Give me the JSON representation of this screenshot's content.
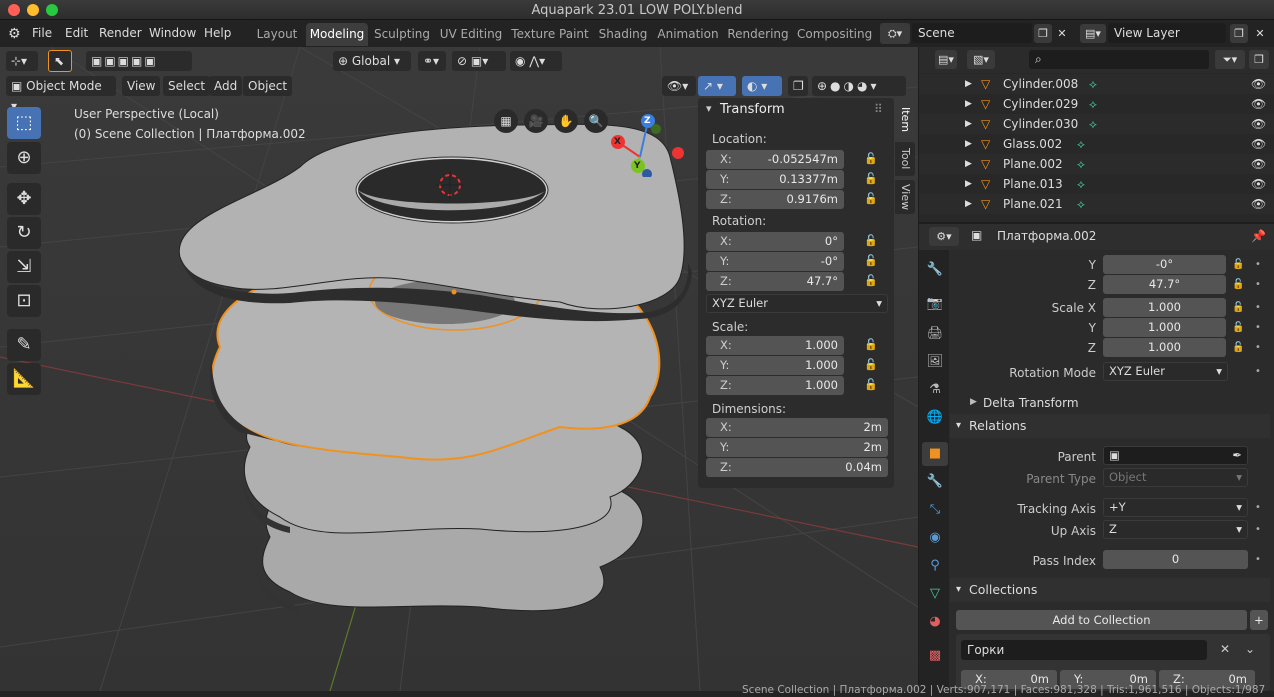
{
  "window": {
    "title": "Aquapark 23.01 LOW POLY.blend"
  },
  "menu": [
    "File",
    "Edit",
    "Render",
    "Window",
    "Help"
  ],
  "workspaces": [
    "Layout",
    "Modeling",
    "Sculpting",
    "UV Editing",
    "Texture Paint",
    "Shading",
    "Animation",
    "Rendering",
    "Compositing"
  ],
  "scene": {
    "name": "Scene",
    "view_layer": "View Layer"
  },
  "viewport": {
    "transform_orientation": "Global",
    "mode": "Object Mode",
    "menus": [
      "View",
      "Select",
      "Add",
      "Object"
    ],
    "perspective": "User Perspective (Local)",
    "collection_info": "(0) Scene Collection | Платформа.002",
    "gizmo": {
      "x": "X",
      "y": "Y",
      "z": "Z"
    }
  },
  "npanel": {
    "title": "Transform",
    "tabs": [
      "Item",
      "Tool",
      "View"
    ],
    "location_label": "Location:",
    "location": [
      {
        "axis": "X:",
        "value": "-0.052547m"
      },
      {
        "axis": "Y:",
        "value": "0.13377m"
      },
      {
        "axis": "Z:",
        "value": "0.9176m"
      }
    ],
    "rotation_label": "Rotation:",
    "rotation": [
      {
        "axis": "X:",
        "value": "0°"
      },
      {
        "axis": "Y:",
        "value": "-0°"
      },
      {
        "axis": "Z:",
        "value": "47.7°"
      }
    ],
    "rotation_mode": "XYZ Euler",
    "scale_label": "Scale:",
    "scale": [
      {
        "axis": "X:",
        "value": "1.000"
      },
      {
        "axis": "Y:",
        "value": "1.000"
      },
      {
        "axis": "Z:",
        "value": "1.000"
      }
    ],
    "dimensions_label": "Dimensions:",
    "dimensions": [
      {
        "axis": "X:",
        "value": "2m"
      },
      {
        "axis": "Y:",
        "value": "2m"
      },
      {
        "axis": "Z:",
        "value": "0.04m"
      }
    ]
  },
  "outliner": {
    "items": [
      "Cylinder.008",
      "Cylinder.029",
      "Cylinder.030",
      "Glass.002",
      "Plane.002",
      "Plane.013",
      "Plane.021"
    ]
  },
  "properties": {
    "object_name": "Платформа.002",
    "rot_y_label": "Y",
    "rot_y": "-0°",
    "rot_z_label": "Z",
    "rot_z": "47.7°",
    "scale_x_label": "Scale X",
    "scale_x": "1.000",
    "scale_y_label": "Y",
    "scale_y": "1.000",
    "scale_z_label": "Z",
    "scale_z": "1.000",
    "rotation_mode_label": "Rotation Mode",
    "rotation_mode": "XYZ Euler",
    "delta_transform": "Delta Transform",
    "relations": "Relations",
    "parent_label": "Parent",
    "parent_type_label": "Parent Type",
    "parent_type": "Object",
    "tracking_axis_label": "Tracking Axis",
    "tracking_axis": "+Y",
    "up_axis_label": "Up Axis",
    "up_axis": "Z",
    "pass_index_label": "Pass Index",
    "pass_index": "0",
    "collections": "Collections",
    "add_to_collection": "Add to Collection",
    "collection_name": "Горки",
    "offset": [
      {
        "axis": "X:",
        "value": "0m"
      },
      {
        "axis": "Y:",
        "value": "0m"
      },
      {
        "axis": "Z:",
        "value": "0m"
      }
    ]
  },
  "status": {
    "text": "Scene Collection | Платформа.002 | Verts:907,171 | Faces:981,328 | Tris:1,961,516 | Objects:1/987"
  }
}
